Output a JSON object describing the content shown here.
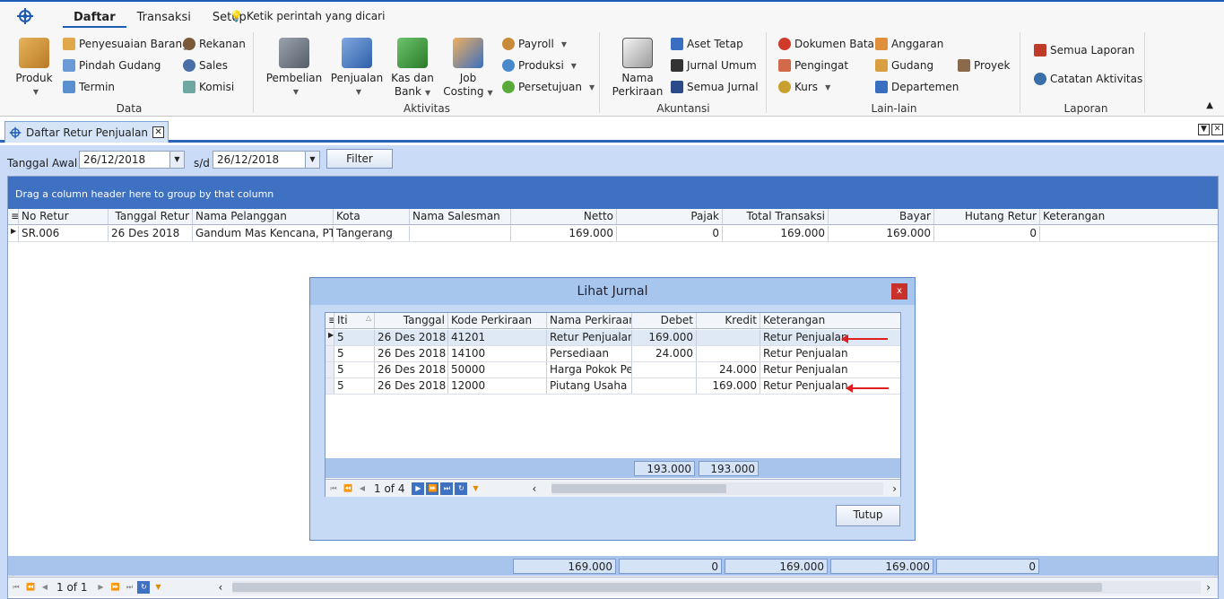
{
  "ribbon": {
    "tabs": [
      "Daftar",
      "Transaksi",
      "Setup"
    ],
    "tellme": "Ketik perintah yang dicari",
    "groups": {
      "data": {
        "label": "Data",
        "big": "Produk",
        "items": [
          "Penyesuaian Barang",
          "Pindah Gudang",
          "Termin",
          "Rekanan",
          "Sales",
          "Komisi"
        ]
      },
      "aktivitas": {
        "label": "Aktivitas",
        "big": [
          [
            "Pembelian"
          ],
          [
            "Penjualan"
          ],
          [
            "Kas dan",
            "Bank"
          ],
          [
            "Job",
            "Costing"
          ]
        ],
        "items": [
          "Payroll",
          "Produksi",
          "Persetujuan"
        ]
      },
      "akuntansi": {
        "label": "Akuntansi",
        "big": [
          "Nama",
          "Perkiraan"
        ],
        "items": [
          "Aset Tetap",
          "Jurnal Umum",
          "Semua Jurnal"
        ]
      },
      "lain": {
        "label": "Lain-lain",
        "items": [
          "Dokumen Batal",
          "Pengingat",
          "Kurs",
          "Anggaran",
          "Gudang",
          "Departemen",
          "Proyek"
        ]
      },
      "laporan": {
        "label": "Laporan",
        "items": [
          "Semua Laporan",
          "Catatan Aktivitas"
        ]
      }
    }
  },
  "doc_tab": "Daftar Retur Penjualan",
  "filter": {
    "label": "Tanggal Awal",
    "from": "26/12/2018",
    "sd": "s/d",
    "to": "26/12/2018",
    "button": "Filter"
  },
  "grid": {
    "group_hint": "Drag a column header here to group by that column",
    "headers": [
      "No Retur",
      "Tanggal Retur",
      "Nama Pelanggan",
      "Kota",
      "Nama Salesman",
      "Netto",
      "Pajak",
      "Total Transaksi",
      "Bayar",
      "Hutang Retur",
      "Keterangan"
    ],
    "rows": [
      [
        "SR.006",
        "26 Des 2018",
        "Gandum Mas Kencana, PT",
        "Tangerang",
        "",
        "169.000",
        "0",
        "169.000",
        "169.000",
        "0",
        ""
      ]
    ],
    "totals": [
      "169.000",
      "0",
      "169.000",
      "169.000",
      "0"
    ],
    "pager": "1 of 1"
  },
  "modal": {
    "title": "Lihat Jurnal",
    "close": "x",
    "headers": [
      "Iti",
      "Tanggal",
      "Kode Perkiraan",
      "Nama Perkiraan",
      "Debet",
      "Kredit",
      "Keterangan"
    ],
    "rows": [
      [
        "5",
        "26 Des 2018",
        "41201",
        "Retur Penjualan",
        "169.000",
        "",
        "Retur Penjualan"
      ],
      [
        "5",
        "26 Des 2018",
        "14100",
        "Persediaan",
        "24.000",
        "",
        "Retur Penjualan"
      ],
      [
        "5",
        "26 Des 2018",
        "50000",
        "Harga Pokok Penju",
        "",
        "24.000",
        "Retur Penjualan"
      ],
      [
        "5",
        "26 Des 2018",
        "12000",
        "Piutang Usaha",
        "",
        "169.000",
        "Retur Penjualan"
      ]
    ],
    "totals": [
      "193.000",
      "193.000"
    ],
    "pager": "1 of 4",
    "button": "Tutup"
  },
  "colors": {
    "accent": "#3f71c2",
    "arrow": "#e02020"
  }
}
